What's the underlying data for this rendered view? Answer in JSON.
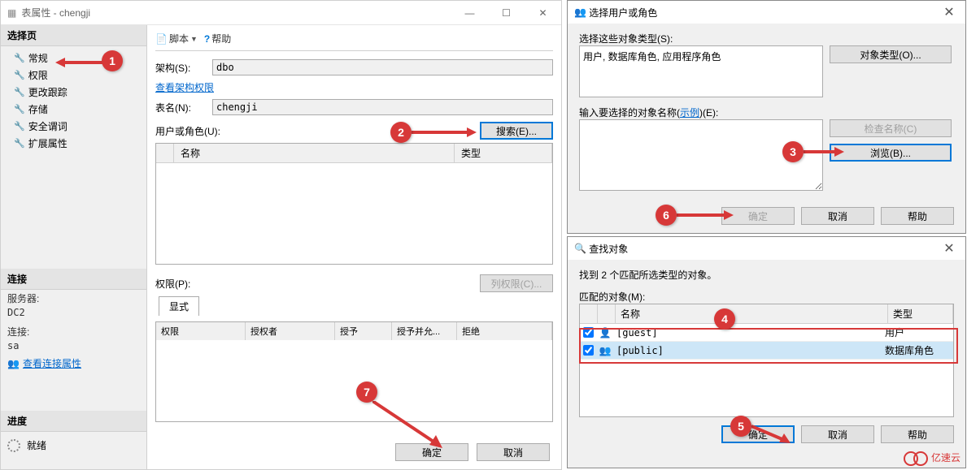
{
  "left_dialog": {
    "title": "表属性 - chengji",
    "sidebar": {
      "select_page_header": "选择页",
      "items": [
        "常规",
        "权限",
        "更改跟踪",
        "存储",
        "安全谓词",
        "扩展属性"
      ],
      "connection_header": "连接",
      "server_label": "服务器:",
      "server_value": "DC2",
      "conn_label": "连接:",
      "conn_value": "sa",
      "view_conn_props": "查看连接属性",
      "progress_header": "进度",
      "progress_status": "就绪"
    },
    "toolbar": {
      "script": "脚本",
      "help": "帮助"
    },
    "form": {
      "schema_label": "架构(S):",
      "schema_value": "dbo",
      "view_schema_perm": "查看架构权限",
      "table_label": "表名(N):",
      "table_value": "chengji",
      "users_label": "用户或角色(U):",
      "search_btn": "搜索(E)...",
      "grid_cols": {
        "name": "名称",
        "type": "类型"
      },
      "perm_label": "权限(P):",
      "column_perm_btn": "列权限(C)...",
      "explicit_tab": "显式",
      "perm_cols": {
        "perm": "权限",
        "grantor": "授权者",
        "grant": "授予",
        "withgrant": "授予并允...",
        "deny": "拒绝"
      }
    },
    "ok": "确定",
    "cancel": "取消"
  },
  "right1": {
    "title": "选择用户或角色",
    "types_label": "选择这些对象类型(S):",
    "types_value": "用户, 数据库角色, 应用程序角色",
    "obj_types_btn": "对象类型(O)...",
    "names_label": "输入要选择的对象名称",
    "example": "示例",
    "names_suffix": "(E):",
    "check_names_btn": "检查名称(C)",
    "browse_btn": "浏览(B)...",
    "ok": "确定",
    "cancel": "取消",
    "help": "帮助"
  },
  "right2": {
    "title": "查找对象",
    "found_msg": "找到 2 个匹配所选类型的对象。",
    "match_label": "匹配的对象(M):",
    "cols": {
      "name": "名称",
      "type": "类型"
    },
    "rows": [
      {
        "name": "[guest]",
        "type": "用户",
        "checked": true
      },
      {
        "name": "[public]",
        "type": "数据库角色",
        "checked": true
      }
    ],
    "ok": "确定",
    "cancel": "取消",
    "help": "帮助"
  },
  "callouts": [
    "1",
    "2",
    "3",
    "4",
    "5",
    "6",
    "7"
  ],
  "watermark": "亿速云"
}
